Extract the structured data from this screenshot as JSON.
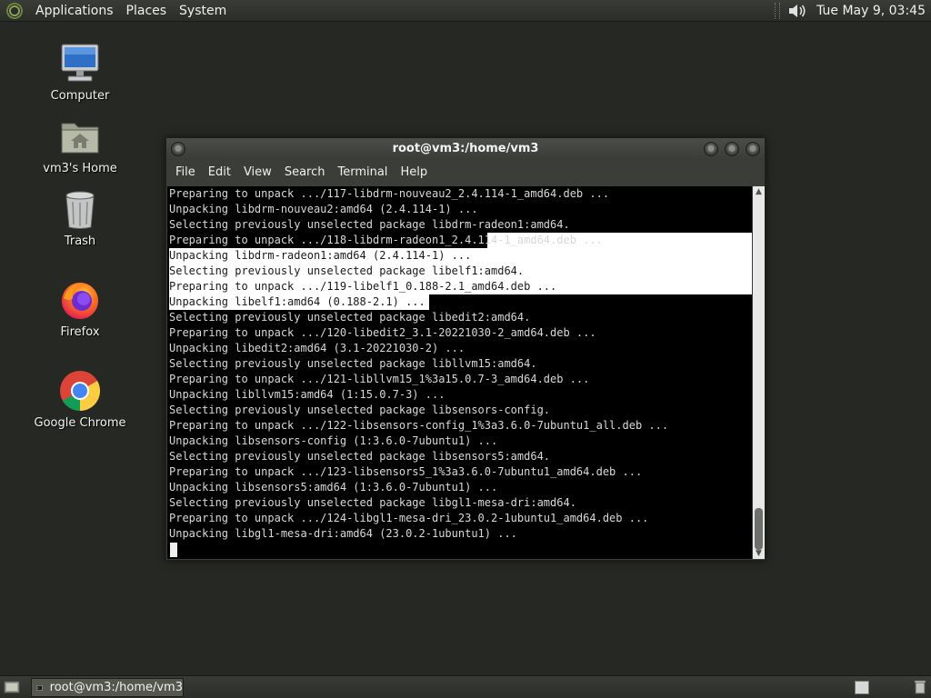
{
  "top_panel": {
    "menus": [
      "Applications",
      "Places",
      "System"
    ],
    "clock": "Tue May  9, 03:45"
  },
  "desktop_icons": {
    "computer": "Computer",
    "home": "vm3's Home",
    "trash": "Trash",
    "firefox": "Firefox",
    "chrome": "Google Chrome"
  },
  "terminal": {
    "title": "root@vm3:/home/vm3",
    "menu": [
      "File",
      "Edit",
      "View",
      "Search",
      "Terminal",
      "Help"
    ],
    "lines": [
      "Preparing to unpack .../117-libdrm-nouveau2_2.4.114-1_amd64.deb ...",
      "Unpacking libdrm-nouveau2:amd64 (2.4.114-1) ...",
      "Selecting previously unselected package libdrm-radeon1:amd64.",
      "Preparing to unpack .../118-libdrm-radeon1_2.4.114-1_amd64.deb ...",
      "Unpacking libdrm-radeon1:amd64 (2.4.114-1) ...",
      "Selecting previously unselected package libelf1:amd64.",
      "Preparing to unpack .../119-libelf1_0.188-2.1_amd64.deb ...",
      "Unpacking libelf1:amd64 (0.188-2.1) ...",
      "Selecting previously unselected package libedit2:amd64.",
      "Preparing to unpack .../120-libedit2_3.1-20221030-2_amd64.deb ...",
      "Unpacking libedit2:amd64 (3.1-20221030-2) ...",
      "Selecting previously unselected package libllvm15:amd64.",
      "Preparing to unpack .../121-libllvm15_1%3a15.0.7-3_amd64.deb ...",
      "Unpacking libllvm15:amd64 (1:15.0.7-3) ...",
      "Selecting previously unselected package libsensors-config.",
      "Preparing to unpack .../122-libsensors-config_1%3a3.6.0-7ubuntu1_all.deb ...",
      "Unpacking libsensors-config (1:3.6.0-7ubuntu1) ...",
      "Selecting previously unselected package libsensors5:amd64.",
      "Preparing to unpack .../123-libsensors5_1%3a3.6.0-7ubuntu1_amd64.deb ...",
      "Unpacking libsensors5:amd64 (1:3.6.0-7ubuntu1) ...",
      "Selecting previously unselected package libgl1-mesa-dri:amd64.",
      "Preparing to unpack .../124-libgl1-mesa-dri_23.0.2-1ubuntu1_amd64.deb ...",
      "Unpacking libgl1-mesa-dri:amd64 (23.0.2-1ubuntu1) ..."
    ]
  },
  "taskbar": {
    "task_label": "root@vm3:/home/vm3"
  }
}
